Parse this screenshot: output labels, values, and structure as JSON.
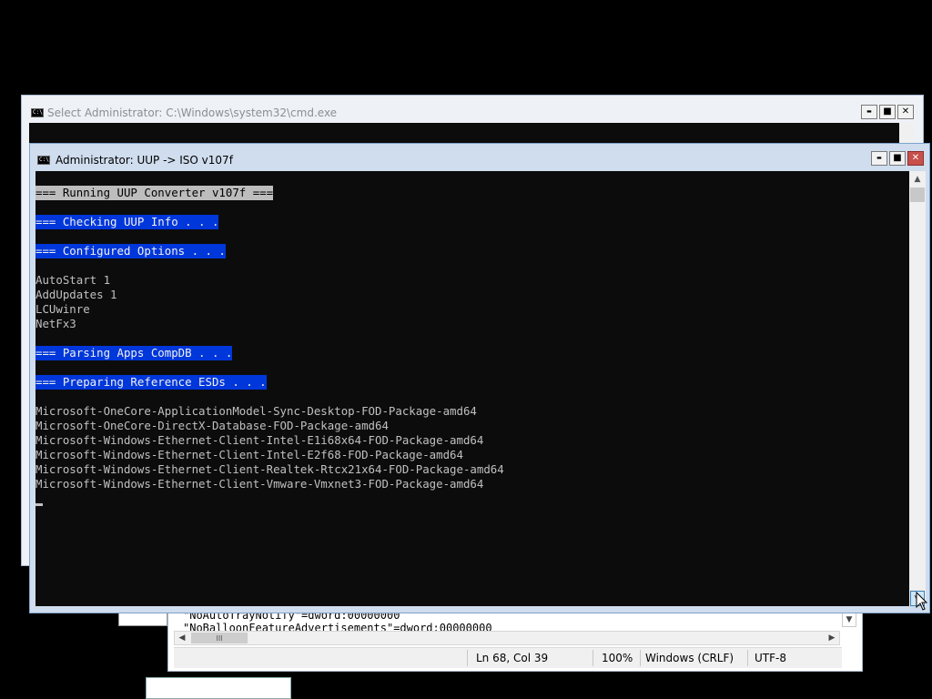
{
  "notepad": {
    "lines": [
      "\"NoAutoTrayNotify\"=dword:00000000",
      "\"NoBalloonFeatureAdvertisements\"=dword:00000000"
    ],
    "hscroll_thumb": "III",
    "status": {
      "position": "Ln 68, Col 39",
      "zoom": "100%",
      "line_ending": "Windows (CRLF)",
      "encoding": "UTF-8"
    }
  },
  "cmd_background": {
    "title": "Select Administrator: C:\\Windows\\system32\\cmd.exe"
  },
  "cmd_foreground": {
    "title": "Administrator:  UUP -> ISO v107f",
    "icon_text": "C:\\",
    "output": [
      {
        "text": "=== Running UUP Converter v107f ===",
        "style": "gray"
      },
      {
        "text": "",
        "style": "plain"
      },
      {
        "text": "=== Checking UUP Info . . .",
        "style": "blue"
      },
      {
        "text": "",
        "style": "plain"
      },
      {
        "text": "=== Configured Options . . .",
        "style": "blue"
      },
      {
        "text": "",
        "style": "plain"
      },
      {
        "text": "AutoStart 1",
        "style": "plain"
      },
      {
        "text": "AddUpdates 1",
        "style": "plain"
      },
      {
        "text": "LCUwinre",
        "style": "plain"
      },
      {
        "text": "NetFx3",
        "style": "plain"
      },
      {
        "text": "",
        "style": "plain"
      },
      {
        "text": "=== Parsing Apps CompDB . . .",
        "style": "blue"
      },
      {
        "text": "",
        "style": "plain"
      },
      {
        "text": "=== Preparing Reference ESDs . . .",
        "style": "blue"
      },
      {
        "text": "",
        "style": "plain"
      },
      {
        "text": "Microsoft-OneCore-ApplicationModel-Sync-Desktop-FOD-Package-amd64",
        "style": "plain"
      },
      {
        "text": "Microsoft-OneCore-DirectX-Database-FOD-Package-amd64",
        "style": "plain"
      },
      {
        "text": "Microsoft-Windows-Ethernet-Client-Intel-E1i68x64-FOD-Package-amd64",
        "style": "plain"
      },
      {
        "text": "Microsoft-Windows-Ethernet-Client-Intel-E2f68-FOD-Package-amd64",
        "style": "plain"
      },
      {
        "text": "Microsoft-Windows-Ethernet-Client-Realtek-Rtcx21x64-FOD-Package-amd64",
        "style": "plain"
      },
      {
        "text": "Microsoft-Windows-Ethernet-Client-Vmware-Vmxnet3-FOD-Package-amd64",
        "style": "plain"
      },
      {
        "text": "",
        "style": "plain"
      }
    ]
  },
  "window_buttons": {
    "minimize": "▬",
    "maximize": "■",
    "close": "✕"
  },
  "colors": {
    "console_bg": "#0c0c0c",
    "console_fg": "#c0c0c0",
    "highlight_blue": "#0037da",
    "highlight_gray": "#bdbdbd",
    "close_button": "#c7504a"
  }
}
